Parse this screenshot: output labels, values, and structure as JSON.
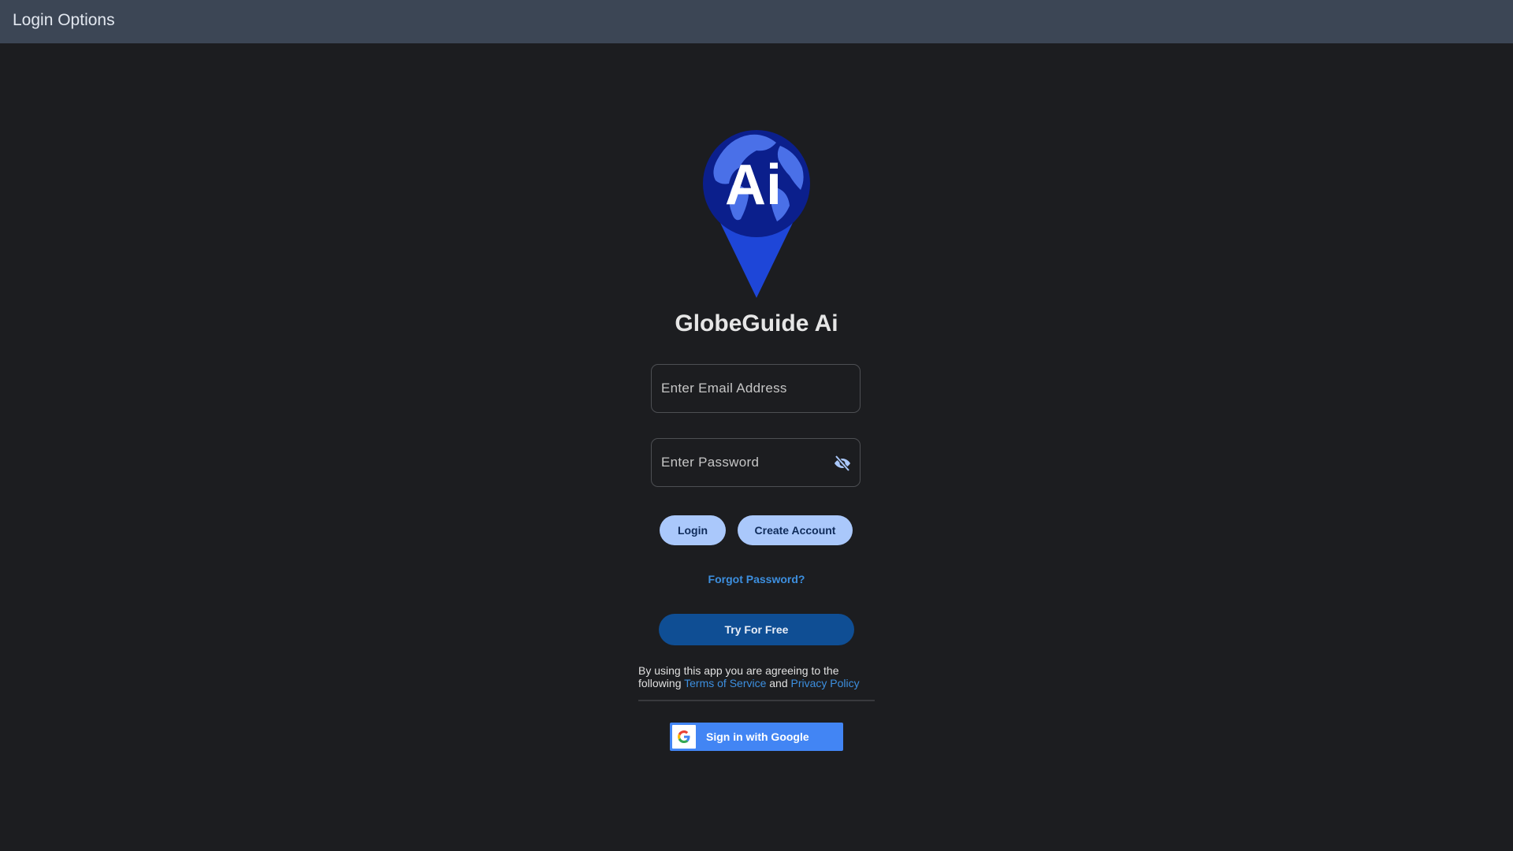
{
  "header": {
    "title": "Login Options"
  },
  "app": {
    "name": "GlobeGuide Ai",
    "logo_text": "Ai",
    "brand_color": "#1a47d6"
  },
  "email": {
    "placeholder": "Enter Email Address",
    "value": ""
  },
  "password": {
    "placeholder": "Enter Password",
    "value": "",
    "toggle_icon": "eye-off-icon"
  },
  "buttons": {
    "login": "Login",
    "create_account": "Create Account",
    "forgot_password": "Forgot Password?",
    "try_free": "Try For Free"
  },
  "terms": {
    "prefix": "By using this app you are agreeing to the following",
    "terms_link": "Terms of Service",
    "conjunction": "and",
    "privacy_link": "Privacy Policy"
  },
  "google": {
    "label": "Sign in with Google",
    "icon": "google-g-icon"
  }
}
